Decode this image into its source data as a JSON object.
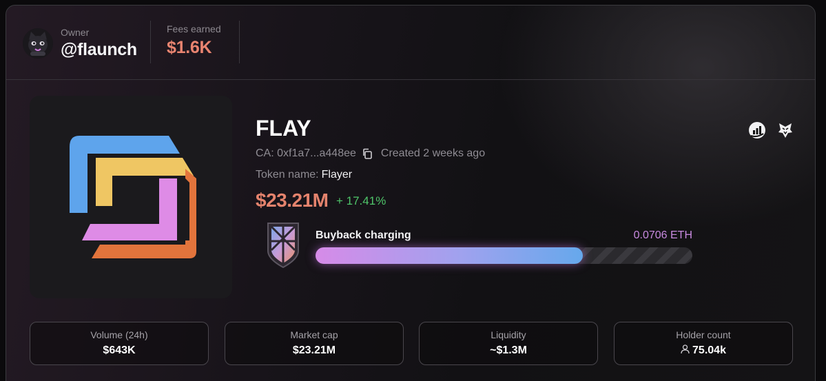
{
  "owner": {
    "label": "Owner",
    "handle": "@flaunch",
    "avatar_icon": "black-cat-avatar"
  },
  "fees": {
    "label": "Fees earned",
    "value": "$1.6K"
  },
  "token": {
    "symbol": "FLAY",
    "ca_text": "CA: 0xf1a7...a448ee",
    "created": "Created 2 weeks ago",
    "name_label": "Token name:",
    "name_value": "Flayer",
    "price": "$23.21M",
    "change": "+ 17.41%",
    "logo_icon": "flaunch-logo"
  },
  "buyback": {
    "label": "Buyback charging",
    "value": "0.0706 ETH",
    "progress": 0.71
  },
  "links": {
    "icons": [
      "chart-icon",
      "eagle-icon"
    ]
  },
  "stats": [
    {
      "label": "Volume (24h)",
      "value": "$643K"
    },
    {
      "label": "Market cap",
      "value": "$23.21M"
    },
    {
      "label": "Liquidity",
      "value": "~$1.3M"
    },
    {
      "label": "Holder count",
      "value": "75.04k"
    }
  ],
  "colors": {
    "price": "#e5836d",
    "change_positive": "#4fc56a",
    "fees": "#e98470",
    "buyback_value": "#c88adf"
  }
}
